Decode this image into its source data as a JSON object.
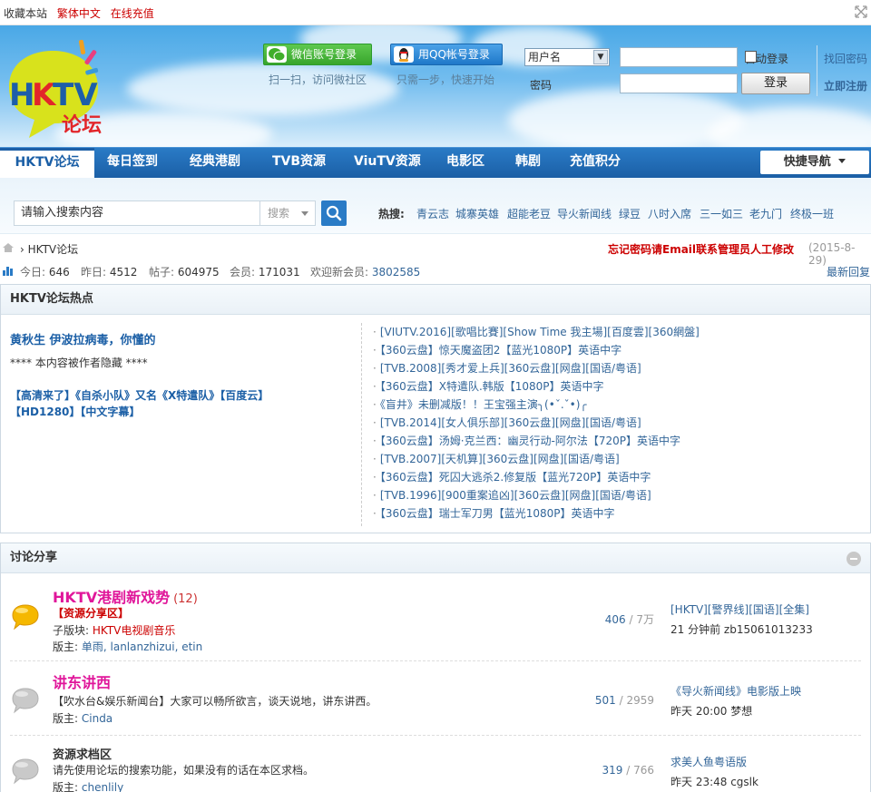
{
  "topbar": {
    "favorite": "收藏本站",
    "traditional": "繁体中文",
    "recharge": "在线充值"
  },
  "header": {
    "logo_text": "HKTV",
    "logo_sub": "论坛",
    "wechat_btn": "微信账号登录",
    "wechat_sub": "扫一扫，访问微社区",
    "qq_btn": "用QQ帐号登录",
    "qq_sub": "只需一步，快速开始",
    "username_select": "用户名",
    "password_label": "密码",
    "auto_login": "自动登录",
    "login_btn": "登录",
    "forgot": "找回密码",
    "register": "立即注册"
  },
  "nav": {
    "items": [
      "HKTV论坛",
      "每日签到",
      "经典港剧",
      "TVB资源",
      "ViuTV资源",
      "电影区",
      "韩剧",
      "充值积分"
    ],
    "quick": "快捷导航"
  },
  "search": {
    "placeholder": "请输入搜索内容",
    "type": "搜索",
    "hot_label": "热搜:",
    "hot_tags": [
      "青云志",
      "城寨英雄",
      "超能老豆",
      "导火新闻线",
      "绿豆",
      "八时入席",
      "三一如三",
      "老九门",
      "终极一班"
    ]
  },
  "breadcrumb": {
    "current": "HKTV论坛",
    "notice": "忘记密码请Email联系管理员人工修改",
    "date": "(2015-8-29)"
  },
  "stats": {
    "today_label": "今日:",
    "today": "646",
    "yesterday_label": "昨日:",
    "yesterday": "4512",
    "posts_label": "帖子:",
    "posts": "604975",
    "members_label": "会员:",
    "members": "171031",
    "newest_label": "欢迎新会员:",
    "newest": "3802585",
    "latest_reply": "最新回复"
  },
  "hot": {
    "heading": "HKTV论坛热点",
    "featured_title": "黄秋生 伊波拉病毒，你懂的",
    "hidden_note": "**** 本内容被作者隐藏 ****",
    "featured_sub1": "【高清来了】《自杀小队》又名《X特遣队》【百度云】",
    "featured_sub2": "【HD1280】【中文字幕】",
    "list": [
      "[VIUTV.2016][歌唱比賽][Show Time 我主場][百度雲][360網盤]",
      "【360云盘】惊天魔盗团2【蓝光1080P】英语中字",
      "[TVB.2008][秀才爱上兵][360云盘][网盘][国语/粤语]",
      "【360云盘】X特遣队.韩版【1080P】英语中字",
      "《盲井》未删减版！！王宝强主演╮(•ˇ.ˇ•)╭",
      "[TVB.2014][女人俱乐部][360云盘][网盘][国语/粤语]",
      "【360云盘】汤姆·克兰西：幽灵行动-阿尔法【720P】英语中字",
      "[TVB.2007][天机算][360云盘][网盘][国语/粤语]",
      "【360云盘】死囚大逃杀2.修复版【蓝光720P】英语中字",
      "[TVB.1996][900重案追凶][360云盘][网盘][国语/粤语]",
      "【360云盘】瑞士军刀男【蓝光1080P】英语中字"
    ]
  },
  "forums": {
    "heading": "讨论分享",
    "rows": [
      {
        "name": "HKTV港剧新戏势",
        "count": "(12)",
        "line1": "【资源分享区】",
        "sub_label": "子版块:",
        "sub_value": "HKTV电视剧音乐",
        "mod_label": "版主:",
        "mods": "单雨, lanlanzhizui, etin",
        "threads": "406",
        "posts": "/ 7万",
        "last_title": "[HKTV][警界线][国语][全集]",
        "last_meta": "21 分钟前  zb15061013233"
      },
      {
        "name": "讲东讲西",
        "line1": "【吹水台&娱乐新闻台】大家可以畅所欲言，谈天说地，讲东讲西。",
        "mod_label": "版主:",
        "mods": "Cinda",
        "threads": "501",
        "posts": "/ 2959",
        "last_title": "《导火新闻线》电影版上映",
        "last_meta": "昨天 20:00  梦想"
      },
      {
        "name": "资源求档区",
        "line1": "请先使用论坛的搜索功能，如果没有的话在本区求档。",
        "mod_label": "版主:",
        "mods": "chenlily",
        "threads": "319",
        "posts": "/ 766",
        "last_title": "求美人鱼粤语版",
        "last_meta": "昨天 23:48  cgslk"
      }
    ]
  },
  "colors": {
    "nav_blue": "#1b5fa6",
    "link": "#336699",
    "notice_red": "#cc0000",
    "forum_pink": "#e0169a"
  }
}
